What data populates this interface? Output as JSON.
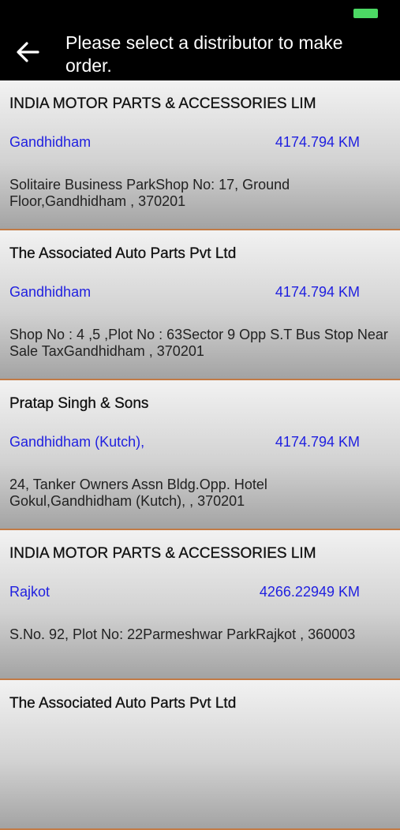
{
  "header": {
    "title": "Please select a distributor to make order."
  },
  "icons": {
    "back": "arrow-left-icon",
    "battery": "battery-icon"
  },
  "colors": {
    "link": "#1f1fe0",
    "divider": "#c27a45",
    "battery": "#4cd964"
  },
  "distributors": [
    {
      "name": "INDIA MOTOR PARTS & ACCESSORIES LIM",
      "city": "Gandhidham",
      "distance": "4174.794 KM",
      "address": "Solitaire Business ParkShop No: 17, Ground Floor,Gandhidham , 370201"
    },
    {
      "name": "The Associated Auto Parts Pvt Ltd",
      "city": "Gandhidham",
      "distance": "4174.794 KM",
      "address": "Shop No : 4 ,5 ,Plot No : 63Sector 9 Opp S.T Bus Stop Near Sale TaxGandhidham , 370201"
    },
    {
      "name": "Pratap Singh & Sons",
      "city": "Gandhidham (Kutch),",
      "distance": "4174.794 KM",
      "address": "24, Tanker Owners Assn Bldg.Opp. Hotel Gokul,Gandhidham (Kutch), , 370201"
    },
    {
      "name": "INDIA MOTOR PARTS & ACCESSORIES LIM",
      "city": "Rajkot",
      "distance": "4266.22949 KM",
      "address": "S.No. 92, Plot No: 22Parmeshwar ParkRajkot , 360003"
    },
    {
      "name": "The Associated Auto Parts Pvt Ltd",
      "city": "",
      "distance": "",
      "address": ""
    }
  ]
}
